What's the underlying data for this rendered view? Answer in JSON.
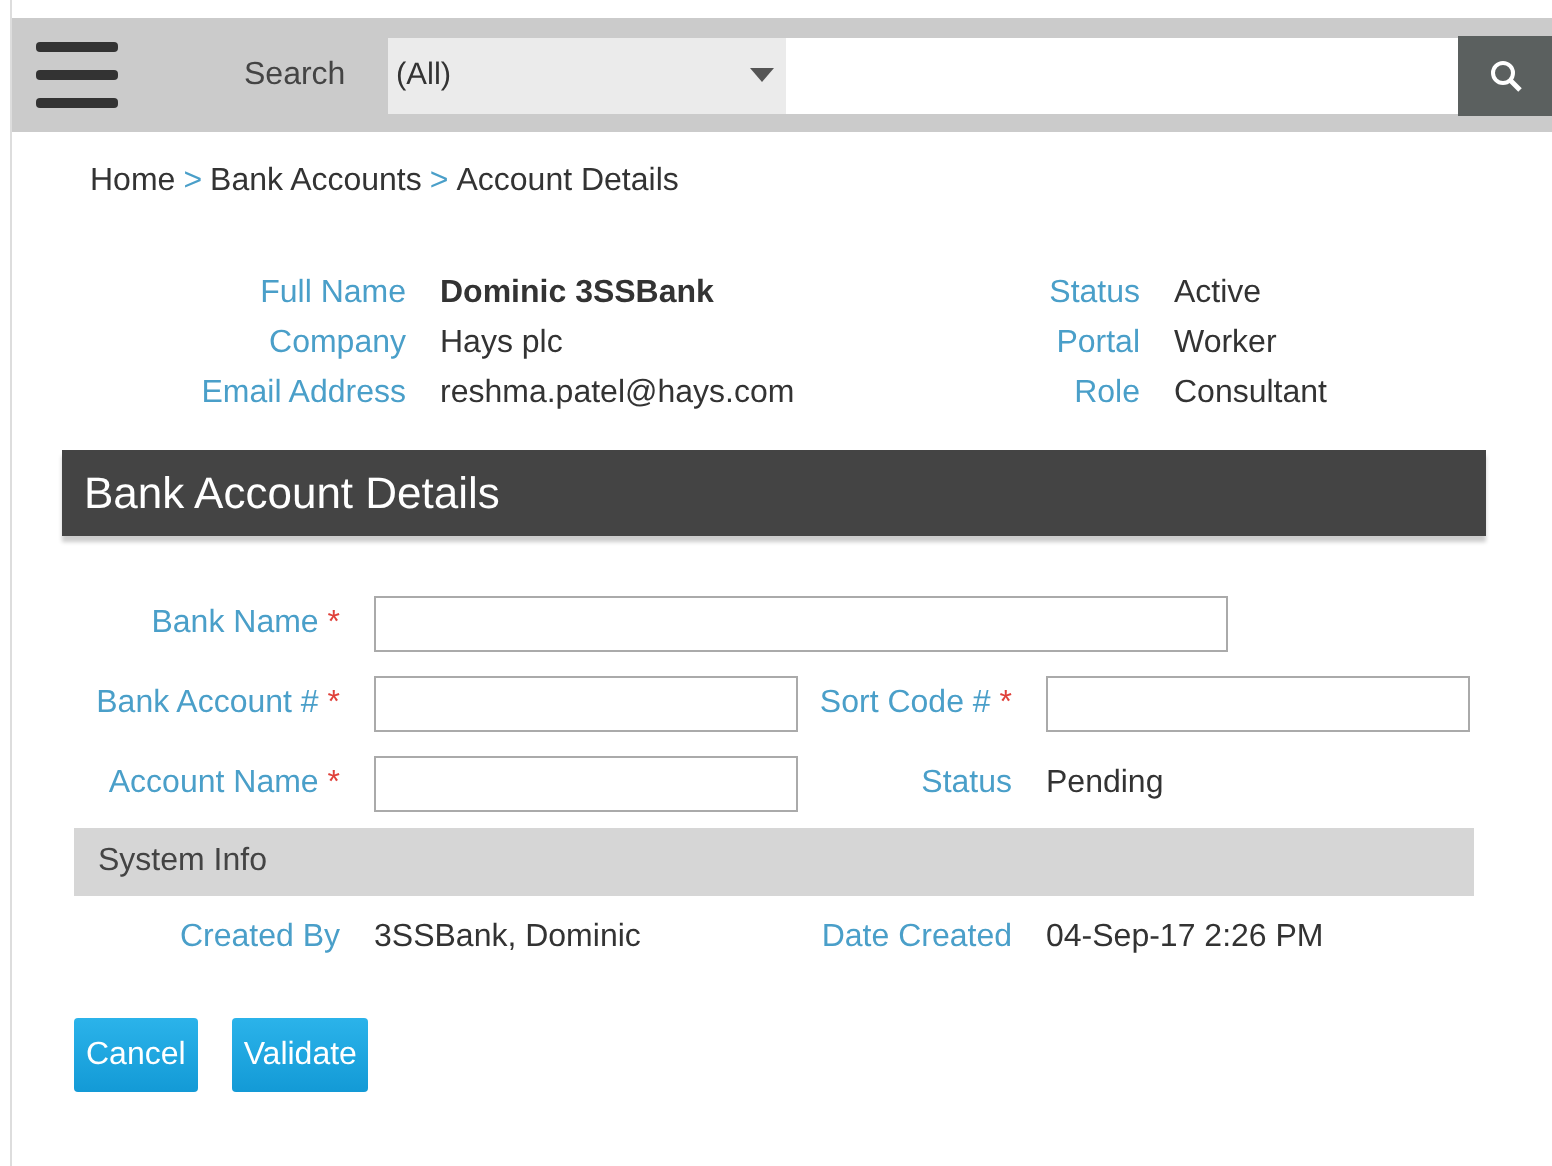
{
  "toolbar": {
    "search_label": "Search",
    "scope": "(All)"
  },
  "breadcrumb": {
    "separator": ">",
    "items": [
      {
        "label": "Home"
      },
      {
        "label": "Bank Accounts"
      },
      {
        "label": "Account Details"
      }
    ]
  },
  "profile": [
    {
      "label": "Full Name",
      "value": "Dominic 3SSBank",
      "bold": true
    },
    {
      "label": "Status",
      "value": "Active",
      "bold": false
    },
    {
      "label": "Company",
      "value": "Hays plc",
      "bold": false
    },
    {
      "label": "Portal",
      "value": "Worker",
      "bold": false
    },
    {
      "label": "Email Address",
      "value": "reshma.patel@hays.com",
      "bold": false
    },
    {
      "label": "Role",
      "value": "Consultant",
      "bold": false
    }
  ],
  "section": {
    "title": "Bank Account Details"
  },
  "form": {
    "rows": [
      [
        {
          "kind": "input",
          "label": "Bank Name",
          "required": true,
          "wide": true
        }
      ],
      [
        {
          "kind": "input",
          "label": "Bank Account #",
          "required": true,
          "wide": false
        },
        {
          "kind": "input",
          "label": "Sort Code #",
          "required": true,
          "wide": false
        }
      ],
      [
        {
          "kind": "input",
          "label": "Account Name",
          "required": true,
          "wide": false
        },
        {
          "kind": "text",
          "label": "Status",
          "value": "Pending"
        }
      ]
    ],
    "required_mark": "*"
  },
  "system_info": {
    "title": "System Info",
    "fields": [
      {
        "label": "Created By",
        "value": "3SSBank, Dominic"
      },
      {
        "label": "Date Created",
        "value": "04-Sep-17 2:26 PM"
      }
    ]
  },
  "buttons": [
    {
      "label": "Cancel"
    },
    {
      "label": "Validate"
    }
  ]
}
